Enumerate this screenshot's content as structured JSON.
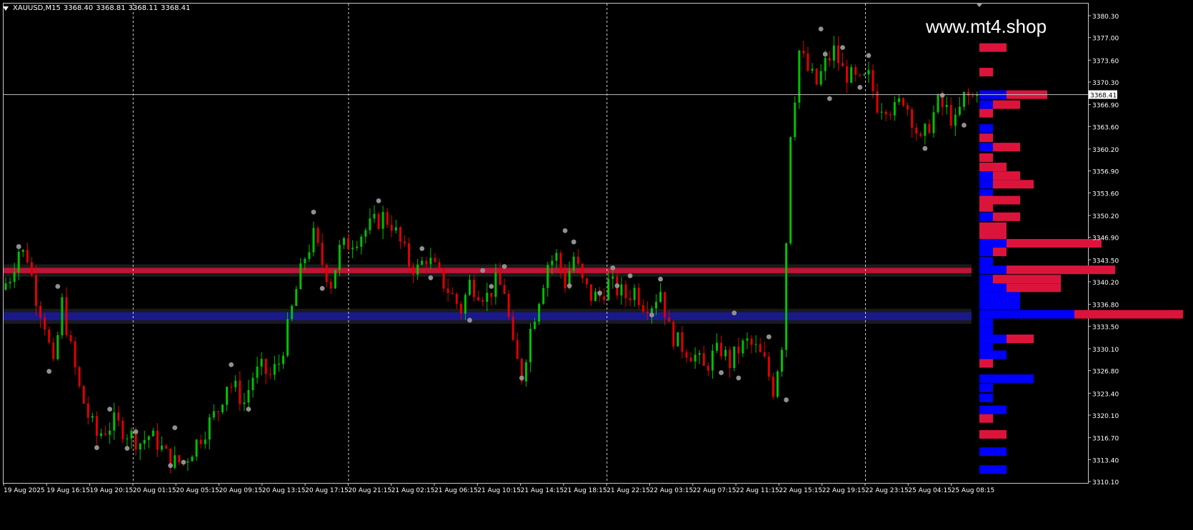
{
  "header": {
    "symbol": "XAUUSD,M15",
    "open": "3368.40",
    "high": "3368.81",
    "low": "3368.11",
    "close": "3368.41"
  },
  "watermark": "www.mt4.shop",
  "colors": {
    "background": "#000000",
    "bull_candle": "#00c000",
    "bear_candle": "#e00000",
    "grid": "#ffffff",
    "axis_text": "#ffffff",
    "profile_sell": "#dc143c",
    "profile_buy": "#0000ff",
    "resistance_zone": "#dc143c",
    "support_zone": "#1a1aa0",
    "swing_marker": "#909090"
  },
  "chart_data": {
    "type": "candlestick",
    "symbol": "XAUUSD",
    "timeframe": "M15",
    "ylim": [
      3310.1,
      3380.3
    ],
    "last_price": 3368.41,
    "last_price_label": "3368.41",
    "y_ticks": [
      "3380.30",
      "3377.00",
      "3373.60",
      "3370.30",
      "3366.90",
      "3363.60",
      "3360.20",
      "3356.90",
      "3353.60",
      "3350.20",
      "3346.90",
      "3343.50",
      "3340.20",
      "3336.80",
      "3333.50",
      "3330.10",
      "3326.80",
      "3323.40",
      "3320.10",
      "3316.70",
      "3313.40",
      "3310.10"
    ],
    "x_ticks": [
      "19 Aug 2025",
      "19 Aug 16:15",
      "19 Aug 20:15",
      "20 Aug 01:15",
      "20 Aug 05:15",
      "20 Aug 09:15",
      "20 Aug 13:15",
      "20 Aug 17:15",
      "20 Aug 21:15",
      "21 Aug 02:15",
      "21 Aug 06:15",
      "21 Aug 10:15",
      "21 Aug 14:15",
      "21 Aug 18:15",
      "21 Aug 22:15",
      "22 Aug 03:15",
      "22 Aug 07:15",
      "22 Aug 11:15",
      "22 Aug 15:15",
      "22 Aug 19:15",
      "22 Aug 23:15",
      "25 Aug 04:15",
      "25 Aug 08:15"
    ],
    "session_separators": [
      "20 Aug 01:15",
      "20 Aug 21:15",
      "21 Aug 22:15",
      "22 Aug 23:15"
    ],
    "zones": [
      {
        "kind": "resistance",
        "from": 3341.5,
        "to": 3342.3
      },
      {
        "kind": "support",
        "from": 3334.4,
        "to": 3335.6
      }
    ],
    "price_path": [
      [
        0,
        3339
      ],
      [
        2,
        3341
      ],
      [
        4,
        3345
      ],
      [
        6,
        3344
      ],
      [
        8,
        3338
      ],
      [
        10,
        3334
      ],
      [
        12,
        3327
      ],
      [
        14,
        3337
      ],
      [
        16,
        3330
      ],
      [
        18,
        3324
      ],
      [
        20,
        3320
      ],
      [
        22,
        3317
      ],
      [
        24,
        3318
      ],
      [
        26,
        3319
      ],
      [
        28,
        3318
      ],
      [
        30,
        3317
      ],
      [
        32,
        3316
      ],
      [
        34,
        3317
      ],
      [
        36,
        3316
      ],
      [
        38,
        3314
      ],
      [
        40,
        3313
      ],
      [
        42,
        3313
      ],
      [
        44,
        3315
      ],
      [
        46,
        3317
      ],
      [
        48,
        3319
      ],
      [
        50,
        3321
      ],
      [
        52,
        3325
      ],
      [
        54,
        3324
      ],
      [
        56,
        3322
      ],
      [
        58,
        3326
      ],
      [
        60,
        3327
      ],
      [
        62,
        3326
      ],
      [
        64,
        3328
      ],
      [
        66,
        3333
      ],
      [
        68,
        3339
      ],
      [
        70,
        3344
      ],
      [
        72,
        3347
      ],
      [
        74,
        3343
      ],
      [
        76,
        3340
      ],
      [
        78,
        3345
      ],
      [
        80,
        3346
      ],
      [
        82,
        3347
      ],
      [
        84,
        3348
      ],
      [
        86,
        3349
      ],
      [
        88,
        3350
      ],
      [
        90,
        3349
      ],
      [
        92,
        3346
      ],
      [
        94,
        3343
      ],
      [
        96,
        3342
      ],
      [
        98,
        3344
      ],
      [
        100,
        3342
      ],
      [
        102,
        3340
      ],
      [
        104,
        3338
      ],
      [
        106,
        3336
      ],
      [
        108,
        3340
      ],
      [
        110,
        3339
      ],
      [
        112,
        3338
      ],
      [
        114,
        3340
      ],
      [
        116,
        3339
      ],
      [
        118,
        3330
      ],
      [
        120,
        3326
      ],
      [
        122,
        3333
      ],
      [
        124,
        3338
      ],
      [
        126,
        3343
      ],
      [
        128,
        3344
      ],
      [
        130,
        3340
      ],
      [
        132,
        3344
      ],
      [
        134,
        3340
      ],
      [
        136,
        3338
      ],
      [
        138,
        3338
      ],
      [
        140,
        3340
      ],
      [
        142,
        3339
      ],
      [
        144,
        3338
      ],
      [
        146,
        3339
      ],
      [
        148,
        3337
      ],
      [
        150,
        3337
      ],
      [
        152,
        3339
      ],
      [
        154,
        3333
      ],
      [
        156,
        3331
      ],
      [
        158,
        3330
      ],
      [
        160,
        3329
      ],
      [
        162,
        3327
      ],
      [
        164,
        3329
      ],
      [
        166,
        3330
      ],
      [
        168,
        3328
      ],
      [
        170,
        3330
      ],
      [
        172,
        3331
      ],
      [
        174,
        3330
      ],
      [
        176,
        3328
      ],
      [
        178,
        3324
      ],
      [
        180,
        3331
      ],
      [
        182,
        3362
      ],
      [
        184,
        3375
      ],
      [
        186,
        3372
      ],
      [
        188,
        3370
      ],
      [
        190,
        3373
      ],
      [
        192,
        3375
      ],
      [
        194,
        3372
      ],
      [
        196,
        3371
      ],
      [
        198,
        3370
      ],
      [
        200,
        3371
      ],
      [
        202,
        3367
      ],
      [
        204,
        3367
      ],
      [
        206,
        3366
      ],
      [
        208,
        3368
      ],
      [
        210,
        3365
      ],
      [
        212,
        3361
      ],
      [
        214,
        3364
      ],
      [
        216,
        3367
      ],
      [
        218,
        3366
      ],
      [
        220,
        3364
      ],
      [
        222,
        3368
      ],
      [
        224,
        3368
      ]
    ],
    "price_noise": 1.6,
    "swing_points": [
      [
        3,
        3345.5
      ],
      [
        10,
        3326.7
      ],
      [
        12,
        3339.5
      ],
      [
        21,
        3315.2
      ],
      [
        24,
        3321
      ],
      [
        28,
        3315.1
      ],
      [
        30,
        3317.6
      ],
      [
        38,
        3312.5
      ],
      [
        39,
        3318.2
      ],
      [
        41,
        3313
      ],
      [
        52,
        3327.7
      ],
      [
        56,
        3321
      ],
      [
        71,
        3350.7
      ],
      [
        73,
        3339.2
      ],
      [
        86,
        3352.4
      ],
      [
        96,
        3345.2
      ],
      [
        98,
        3340.8
      ],
      [
        107,
        3334.4
      ],
      [
        110,
        3341.9
      ],
      [
        112,
        3339.5
      ],
      [
        115,
        3342.5
      ],
      [
        119,
        3325.7
      ],
      [
        129,
        3347.9
      ],
      [
        130,
        3339.6
      ],
      [
        131,
        3346.2
      ],
      [
        137,
        3338.5
      ],
      [
        140,
        3342.3
      ],
      [
        141,
        3339.6
      ],
      [
        144,
        3341.1
      ],
      [
        149,
        3335.2
      ],
      [
        151,
        3340.6
      ],
      [
        165,
        3326.5
      ],
      [
        168,
        3335.5
      ],
      [
        169,
        3325.7
      ],
      [
        176,
        3331.9
      ],
      [
        180,
        3322.4
      ],
      [
        188,
        3378.3
      ],
      [
        189,
        3374.5
      ],
      [
        190,
        3367.8
      ],
      [
        193,
        3375.5
      ],
      [
        197,
        3369.5
      ],
      [
        199,
        3374.3
      ],
      [
        212,
        3360.3
      ],
      [
        216,
        3368.3
      ],
      [
        221,
        3363.8
      ]
    ],
    "volume_profile": [
      {
        "price": 3375.5,
        "sell": 2,
        "buy": 0
      },
      {
        "price": 3371.8,
        "sell": 1,
        "buy": 0
      },
      {
        "price": 3368.4,
        "sell": 3,
        "buy": 2
      },
      {
        "price": 3366.9,
        "sell": 2,
        "buy": 1
      },
      {
        "price": 3365.6,
        "sell": 1,
        "buy": 0
      },
      {
        "price": 3363.3,
        "sell": 0,
        "buy": 1
      },
      {
        "price": 3361.9,
        "sell": 1,
        "buy": 0
      },
      {
        "price": 3360.5,
        "sell": 2,
        "buy": 1
      },
      {
        "price": 3358.9,
        "sell": 1,
        "buy": 0
      },
      {
        "price": 3357.5,
        "sell": 2,
        "buy": 0
      },
      {
        "price": 3356.2,
        "sell": 2,
        "buy": 1
      },
      {
        "price": 3354.9,
        "sell": 3,
        "buy": 1
      },
      {
        "price": 3353.5,
        "sell": 0,
        "buy": 1
      },
      {
        "price": 3352.5,
        "sell": 3,
        "buy": 0
      },
      {
        "price": 3351.4,
        "sell": 1,
        "buy": 0
      },
      {
        "price": 3350.0,
        "sell": 2,
        "buy": 1
      },
      {
        "price": 3348.5,
        "sell": 2,
        "buy": 0
      },
      {
        "price": 3347.3,
        "sell": 2,
        "buy": 0
      },
      {
        "price": 3346.0,
        "sell": 7,
        "buy": 2
      },
      {
        "price": 3344.7,
        "sell": 1,
        "buy": 1
      },
      {
        "price": 3343.3,
        "sell": 0,
        "buy": 1
      },
      {
        "price": 3342.0,
        "sell": 8,
        "buy": 2
      },
      {
        "price": 3340.6,
        "sell": 5,
        "buy": 1
      },
      {
        "price": 3339.3,
        "sell": 4,
        "buy": 2
      },
      {
        "price": 3338.0,
        "sell": 0,
        "buy": 3
      },
      {
        "price": 3336.7,
        "sell": 0,
        "buy": 3
      },
      {
        "price": 3335.3,
        "sell": 8,
        "buy": 7
      },
      {
        "price": 3334.0,
        "sell": 0,
        "buy": 1
      },
      {
        "price": 3332.7,
        "sell": 0,
        "buy": 1
      },
      {
        "price": 3331.6,
        "sell": 2,
        "buy": 2
      },
      {
        "price": 3330.3,
        "sell": 0,
        "buy": 1
      },
      {
        "price": 3329.2,
        "sell": 0,
        "buy": 2
      },
      {
        "price": 3327.9,
        "sell": 1,
        "buy": 0
      },
      {
        "price": 3325.6,
        "sell": 0,
        "buy": 4
      },
      {
        "price": 3324.2,
        "sell": 0,
        "buy": 1
      },
      {
        "price": 3322.7,
        "sell": 0,
        "buy": 1
      },
      {
        "price": 3320.9,
        "sell": 0,
        "buy": 2
      },
      {
        "price": 3319.6,
        "sell": 1,
        "buy": 0
      },
      {
        "price": 3317.2,
        "sell": 2,
        "buy": 0
      },
      {
        "price": 3314.6,
        "sell": 0,
        "buy": 2
      },
      {
        "price": 3311.9,
        "sell": 0,
        "buy": 2
      }
    ]
  }
}
